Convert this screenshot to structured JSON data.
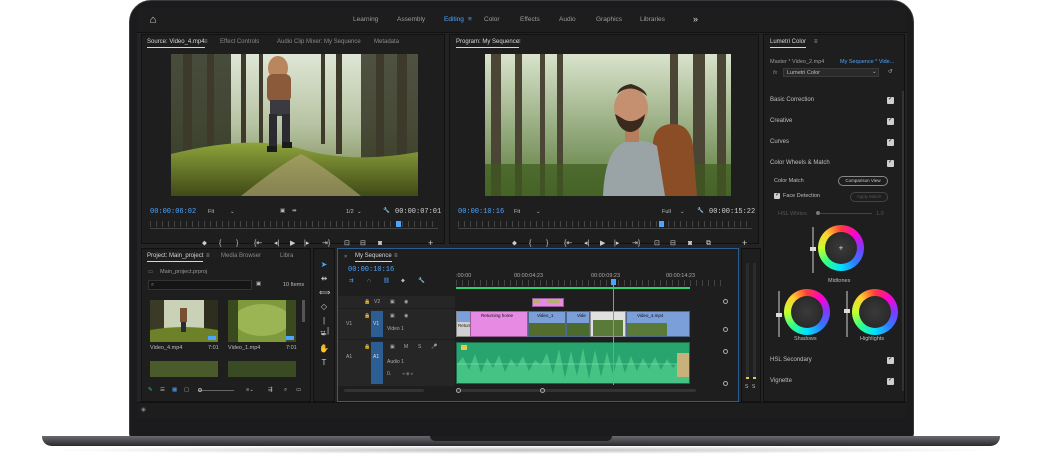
{
  "workspaces": [
    {
      "label": "Learning",
      "active": false
    },
    {
      "label": "Assembly",
      "active": false
    },
    {
      "label": "Editing",
      "active": true
    },
    {
      "label": "Color",
      "active": false
    },
    {
      "label": "Effects",
      "active": false
    },
    {
      "label": "Audio",
      "active": false
    },
    {
      "label": "Graphics",
      "active": false
    },
    {
      "label": "Libraries",
      "active": false
    }
  ],
  "source_panel": {
    "tabs": [
      "Source: Video_4.mp4",
      "Effect Controls",
      "Audio Clip Mixer: My Sequence",
      "Metadata"
    ],
    "current_tc": "00:00:06:02",
    "fit": "Fit",
    "resolution": "1/2",
    "duration_tc": "00:00:07:01",
    "playhead_fraction": 0.86
  },
  "program_panel": {
    "title": "Program: My Sequence",
    "current_tc": "00:00:10:16",
    "fit": "Fit",
    "resolution": "Full",
    "duration_tc": "00:00:15:22",
    "playhead_fraction": 0.69
  },
  "lumetri": {
    "title": "Lumetri Color",
    "source_master": "Master * Video_2.mp4",
    "sequence_link": "My Sequence * Vide...",
    "fx_label": "fx",
    "effect_name": "Lumetri Color",
    "sections": [
      {
        "label": "Basic Correction",
        "checked": true
      },
      {
        "label": "Creative",
        "checked": true
      },
      {
        "label": "Curves",
        "checked": true
      },
      {
        "label": "Color Wheels & Match",
        "checked": true
      }
    ],
    "color_match_label": "Color Match",
    "comparison_view": "Comparison View",
    "face_detection": "Face Detection",
    "apply_match": "Apply Match",
    "hsl_whites_label": "HSL Whites",
    "hsl_whites_value": "1.0",
    "midtones": "Midtones",
    "shadows": "Shadows",
    "highlights": "Highlights",
    "hsl_secondary": "HSL Secondary",
    "vignette": "Vignette"
  },
  "project_panel": {
    "tabs": [
      "Project: Main_project",
      "Media Browser",
      "Libra"
    ],
    "file": "Main_project.prproj",
    "items_count": "10 Items",
    "thumbs": [
      {
        "name": "Video_4.mp4",
        "duration": "7:01"
      },
      {
        "name": "Video_1.mp4",
        "duration": "7:01"
      }
    ]
  },
  "timeline": {
    "sequence_name": "My Sequence",
    "current_tc": "00:00:10:16",
    "ruler": [
      ":00:00",
      "00:00:04:23",
      "00:00:09:23",
      "00:00:14:23"
    ],
    "tracks": {
      "v2": "V2",
      "v1": "V1",
      "v1_name": "Video 1",
      "a1": "A1",
      "a1_name": "Audio 1",
      "a1_m": "M",
      "a1_s": "S",
      "a1_vol": "0.",
      "v1_src": "V1",
      "a1_src": "A1"
    },
    "clips": {
      "title_a": "Returning home",
      "title_sub": "Returning home",
      "v1_a": "Video_1",
      "v1_b": "Vide",
      "v1_c": "Video_4.mp4"
    }
  },
  "meters": [
    "S",
    "S"
  ],
  "colors": {
    "accent_blue": "#4da4ff",
    "audio_green": "#28a56f",
    "title_pink": "#e68ae4",
    "video_blue": "#7a9fd9",
    "clip_tan": "#c8b27a"
  }
}
